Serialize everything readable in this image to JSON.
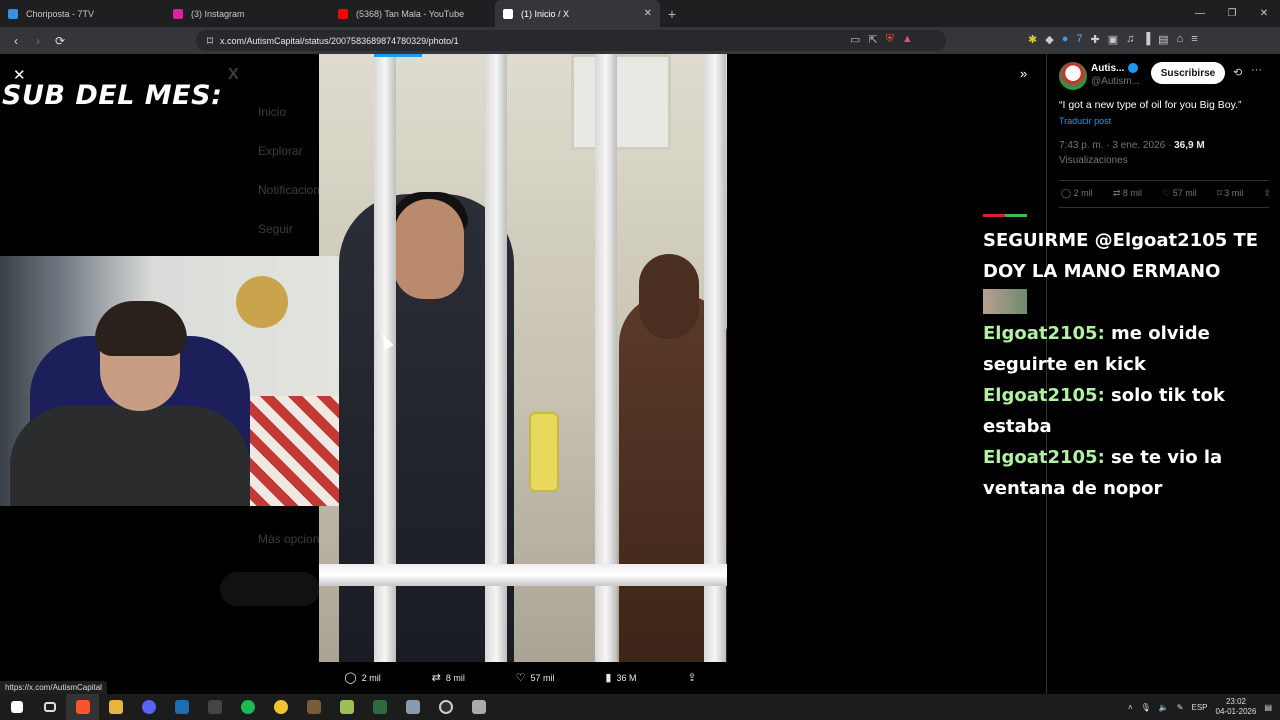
{
  "browser": {
    "tabs": [
      {
        "label": "Choriposta - 7TV",
        "active": false,
        "favicon_color": "#3a8fd8"
      },
      {
        "label": "(3) Instagram",
        "active": false,
        "favicon_color": "#d6249f"
      },
      {
        "label": "(5368) Tan Mala - YouTube",
        "active": false,
        "favicon_color": "#ff0000"
      },
      {
        "label": "(1) Inicio / X",
        "active": true,
        "favicon_color": "#ffffff"
      }
    ],
    "url": "x.com/AutismCapital/status/2007583689874780329/photo/1",
    "status_url": "https://x.com/AutismCapital"
  },
  "overlay": {
    "sub_title": "SUB DEL MES:",
    "chat": [
      {
        "nick": "",
        "text": "SEGUIRME @Elgoat2105 TE DOY LA MANO ERMANO"
      },
      {
        "nick": "Elgoat2105:",
        "text": " me olvide seguirte en kick"
      },
      {
        "nick": "Elgoat2105:",
        "text": " solo tik tok estaba"
      },
      {
        "nick": "Elgoat2105:",
        "text": " se te vio la ventana de nopor"
      }
    ]
  },
  "tweet": {
    "author": "Autis...",
    "handle": "@Autism...",
    "subscribe_label": "Suscribirse",
    "text": "“I got a new type of oil for you Big Boy.”",
    "translate_label": "Traducir post",
    "time": "7:43 p. m. · 3 ene. 2026 · ",
    "views": "36,9 M",
    "views_label": "Visualizaciones",
    "side_actions": {
      "replies": "2 mil",
      "reposts": "8 mil",
      "likes": "57 mil",
      "bookmarks": "3 mil"
    },
    "bottom_actions": {
      "replies": "2 mil",
      "reposts": "8 mil",
      "likes": "57 mil",
      "views": "36 M"
    }
  },
  "background_nav": [
    "Inicio",
    "Explorar",
    "Notificaciones",
    "Seguir",
    "Más opciones"
  ],
  "taskbar": {
    "lang": "ESP",
    "time": "23:02",
    "date": "04-01-2026"
  }
}
